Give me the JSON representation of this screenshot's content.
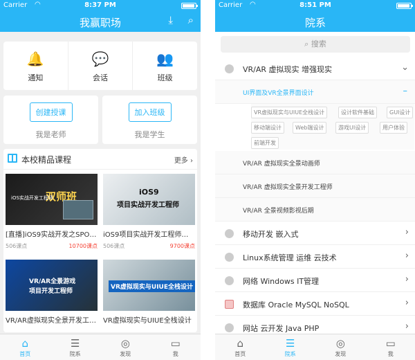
{
  "left": {
    "status": {
      "carrier": "Carrier",
      "time": "8:37 PM"
    },
    "header": {
      "title": "我赢职场",
      "download_icon": "download-icon",
      "search_icon": "search-icon"
    },
    "quick_links": [
      {
        "label": "通知",
        "icon": "bell-icon"
      },
      {
        "label": "会话",
        "icon": "chat-icon"
      },
      {
        "label": "班级",
        "icon": "class-icon"
      }
    ],
    "roles": [
      {
        "button": "创建授课",
        "label": "我是老师"
      },
      {
        "button": "加入班级",
        "label": "我是学生"
      }
    ],
    "courses": {
      "title": "本校精品课程",
      "more": "更多",
      "cards": [
        {
          "thumb_text": "双师班",
          "thumb_sub": "iOS实战开发工程师",
          "title": "[直播]iOS9实战开发之SPO…",
          "students": "506课点",
          "lessons": "10700课点"
        },
        {
          "thumb_text": "iOS9",
          "thumb_sub": "项目实战开发工程师",
          "title": "iOS9项目实战开发工程师…",
          "students": "506课点",
          "lessons": "9700课点"
        },
        {
          "thumb_text": "VR/AR全景游戏",
          "thumb_sub": "项目开发工程师",
          "title": "VR/AR虚拟现实全景开发工…",
          "students": "",
          "lessons": ""
        },
        {
          "thumb_text": "VR虚拟现实与UIUE全栈设计",
          "thumb_sub": "",
          "title": "VR虚拟现实与UIUE全栈设计",
          "students": "",
          "lessons": ""
        }
      ]
    },
    "tabs": [
      {
        "label": "首页",
        "icon": "home-icon",
        "active": true
      },
      {
        "label": "院系",
        "icon": "list-icon",
        "active": false
      },
      {
        "label": "发现",
        "icon": "compass-icon",
        "active": false
      },
      {
        "label": "我",
        "icon": "profile-icon",
        "active": false
      }
    ]
  },
  "right": {
    "status": {
      "carrier": "Carrier",
      "time": "8:51 PM"
    },
    "header": {
      "title": "院系"
    },
    "search": {
      "placeholder": "搜索"
    },
    "expanded_category": "VR/AR 虚拟现实 增强现实",
    "active_subcategory": "UI界面及VR全景界面设计",
    "tags": [
      "VR虚拟现实与UIUE全栈设计",
      "设计软件基础",
      "GUI设计",
      "移动端设计",
      "Web端设计",
      "游戏UI设计",
      "用户体验",
      "前端开发"
    ],
    "subcategories": [
      "VR/AR 虚拟现实全景动画师",
      "VR/AR 虚拟现实全景开发工程师",
      "VR/AR 全景视频影视后期"
    ],
    "categories": [
      "移动开发 嵌入式",
      "Linux系统管理 运维 云技术",
      "网络 Windows IT管理",
      "数据库 Oracle MySQL NoSQL",
      "网站 云开发 Java PHP"
    ],
    "tabs": [
      {
        "label": "首页",
        "icon": "home-icon",
        "active": false
      },
      {
        "label": "院系",
        "icon": "list-icon",
        "active": true
      },
      {
        "label": "发现",
        "icon": "compass-icon",
        "active": false
      },
      {
        "label": "我",
        "icon": "profile-icon",
        "active": false
      }
    ]
  },
  "colors": {
    "accent": "#29b6f6",
    "price": "#f44336"
  }
}
